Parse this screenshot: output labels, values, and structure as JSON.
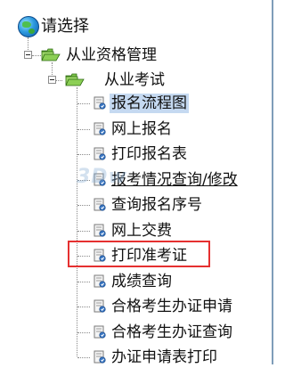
{
  "tree": {
    "root_label": "请选择",
    "level1_label": "从业资格管理",
    "level2_label": "从业考试",
    "items": [
      {
        "label": "报名流程图",
        "selected": true
      },
      {
        "label": "网上报名"
      },
      {
        "label": "打印报名表"
      },
      {
        "label": "报考情况查询/修改",
        "underlined": true
      },
      {
        "label": "查询报名序号"
      },
      {
        "label": "网上交费"
      },
      {
        "label": "打印准考证",
        "highlighted": true
      },
      {
        "label": "成绩查询"
      },
      {
        "label": "合格考生办证申请"
      },
      {
        "label": "合格考生办证查询"
      },
      {
        "label": "办证申请表打印"
      }
    ]
  },
  "watermark": "3Dw",
  "colors": {
    "highlight_border": "#e53030",
    "selection_bg": "#c5d9f1",
    "folder_green": "#7ec64b"
  }
}
